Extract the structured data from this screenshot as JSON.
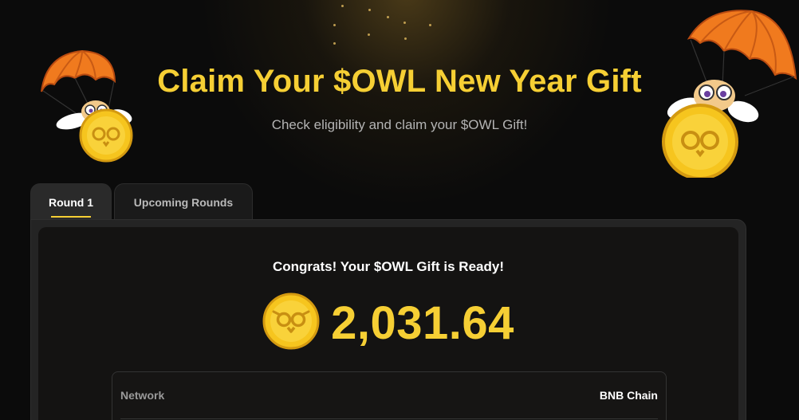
{
  "header": {
    "title": "Claim Your $OWL New Year Gift",
    "subtitle": "Check eligibility and claim your $OWL Gift!"
  },
  "tabs": [
    {
      "label": "Round 1",
      "active": true
    },
    {
      "label": "Upcoming Rounds",
      "active": false
    }
  ],
  "claim": {
    "message": "Congrats! Your $OWL Gift is Ready!",
    "amount": "2,031.64",
    "token_icon": "owl-coin-icon"
  },
  "details": [
    {
      "label": "Network",
      "value": "BNB Chain"
    }
  ],
  "colors": {
    "accent": "#f6cf34",
    "background": "#0b0b0b",
    "panel": "#141312",
    "parachute": "#f07a1e"
  },
  "decorations": {
    "left_mascot": "parachute-owl-coin-icon",
    "right_mascot": "parachute-owl-coin-icon"
  }
}
